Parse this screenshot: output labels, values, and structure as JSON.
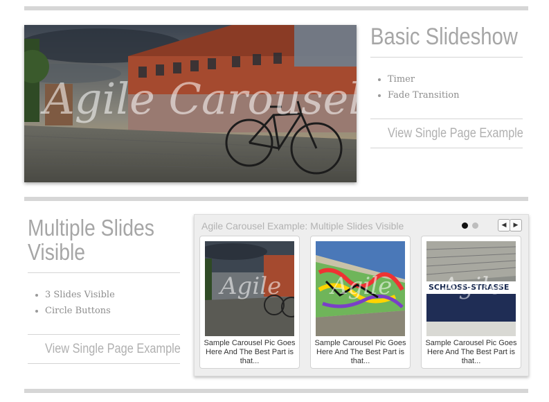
{
  "section1": {
    "title": "Basic Slideshow",
    "watermark": "Agile Carousel",
    "features": [
      "Timer",
      "Fade Transition"
    ],
    "link": "View Single Page Example"
  },
  "section2": {
    "title_line1": "Multiple Slides",
    "title_line2": "Visible",
    "features": [
      "3 Slides Visible",
      "Circle Buttons"
    ],
    "link": "View Single Page Example"
  },
  "carousel": {
    "title": "Agile Carousel Example: Multiple Slides Visible",
    "active_dot": 1,
    "dot_count": 2,
    "prev_icon": "◀",
    "next_icon": "▶",
    "watermark": "Agile",
    "slides": [
      {
        "caption": "Sample Carousel Pic Goes Here And The Best Part is that..."
      },
      {
        "caption": "Sample Carousel Pic Goes Here And The Best Part is that..."
      },
      {
        "caption": "Sample Carousel Pic Goes Here And The Best Part is that..."
      }
    ]
  },
  "colors": {
    "rule": "#d6d6d6",
    "heading": "#a6a6a6",
    "link": "#b0b0b0",
    "dot_active": "#111111",
    "dot_inactive": "#bdbdbd"
  }
}
